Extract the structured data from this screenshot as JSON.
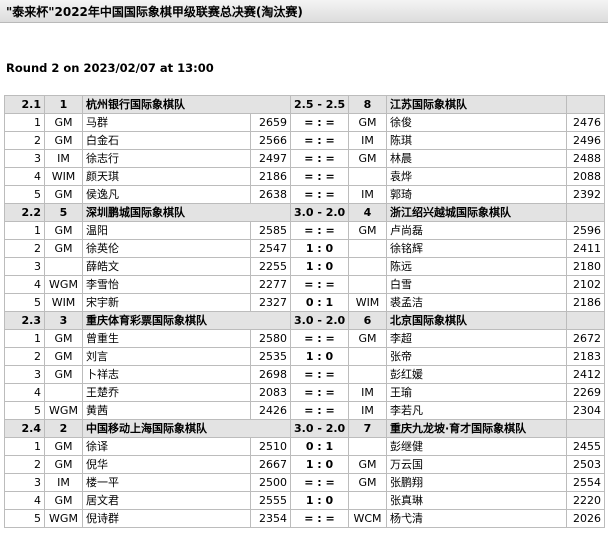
{
  "page": {
    "title": "\"泰来杯\"2022年中国国际象棋甲级联赛总决赛(淘汰赛)",
    "round_info": "Round 2 on 2023/02/07 at 13:00"
  },
  "matches": [
    {
      "board": "2.1",
      "team1_no": "1",
      "team1": "杭州银行国际象棋队",
      "score": "2.5 - 2.5",
      "team2_no": "8",
      "team2": "江苏国际象棋队",
      "games": [
        {
          "b": "1",
          "t1": "GM",
          "p1": "马群",
          "r1": "2659",
          "res": "= : =",
          "t2": "GM",
          "p2": "徐俊",
          "r2": "2476"
        },
        {
          "b": "2",
          "t1": "GM",
          "p1": "白金石",
          "r1": "2566",
          "res": "= : =",
          "t2": "IM",
          "p2": "陈琪",
          "r2": "2496"
        },
        {
          "b": "3",
          "t1": "IM",
          "p1": "徐志行",
          "r1": "2497",
          "res": "= : =",
          "t2": "GM",
          "p2": "林晨",
          "r2": "2488"
        },
        {
          "b": "4",
          "t1": "WIM",
          "p1": "颜天琪",
          "r1": "2186",
          "res": "= : =",
          "t2": "",
          "p2": "袁烨",
          "r2": "2088"
        },
        {
          "b": "5",
          "t1": "GM",
          "p1": "侯逸凡",
          "r1": "2638",
          "res": "= : =",
          "t2": "IM",
          "p2": "郭琦",
          "r2": "2392"
        }
      ]
    },
    {
      "board": "2.2",
      "team1_no": "5",
      "team1": "深圳鹏城国际象棋队",
      "score": "3.0 - 2.0",
      "team2_no": "4",
      "team2": "浙江绍兴越城国际象棋队",
      "games": [
        {
          "b": "1",
          "t1": "GM",
          "p1": "温阳",
          "r1": "2585",
          "res": "= : =",
          "t2": "GM",
          "p2": "卢尚磊",
          "r2": "2596"
        },
        {
          "b": "2",
          "t1": "GM",
          "p1": "徐英伦",
          "r1": "2547",
          "res": "1 : 0",
          "t2": "",
          "p2": "徐铭辉",
          "r2": "2411"
        },
        {
          "b": "3",
          "t1": "",
          "p1": "薛皓文",
          "r1": "2255",
          "res": "1 : 0",
          "t2": "",
          "p2": "陈远",
          "r2": "2180"
        },
        {
          "b": "4",
          "t1": "WGM",
          "p1": "李雪怡",
          "r1": "2277",
          "res": "= : =",
          "t2": "",
          "p2": "白雪",
          "r2": "2102"
        },
        {
          "b": "5",
          "t1": "WIM",
          "p1": "宋宇新",
          "r1": "2327",
          "res": "0 : 1",
          "t2": "WIM",
          "p2": "裘孟洁",
          "r2": "2186"
        }
      ]
    },
    {
      "board": "2.3",
      "team1_no": "3",
      "team1": "重庆体育彩票国际象棋队",
      "score": "3.0 - 2.0",
      "team2_no": "6",
      "team2": "北京国际象棋队",
      "games": [
        {
          "b": "1",
          "t1": "GM",
          "p1": "曾重生",
          "r1": "2580",
          "res": "= : =",
          "t2": "GM",
          "p2": "李超",
          "r2": "2672"
        },
        {
          "b": "2",
          "t1": "GM",
          "p1": "刘言",
          "r1": "2535",
          "res": "1 : 0",
          "t2": "",
          "p2": "张帝",
          "r2": "2183"
        },
        {
          "b": "3",
          "t1": "GM",
          "p1": "卜祥志",
          "r1": "2698",
          "res": "= : =",
          "t2": "",
          "p2": "彭红媛",
          "r2": "2412"
        },
        {
          "b": "4",
          "t1": "",
          "p1": "王楚乔",
          "r1": "2083",
          "res": "= : =",
          "t2": "IM",
          "p2": "王瑜",
          "r2": "2269"
        },
        {
          "b": "5",
          "t1": "WGM",
          "p1": "黄茜",
          "r1": "2426",
          "res": "= : =",
          "t2": "IM",
          "p2": "李若凡",
          "r2": "2304"
        }
      ]
    },
    {
      "board": "2.4",
      "team1_no": "2",
      "team1": "中国移动上海国际象棋队",
      "score": "3.0 - 2.0",
      "team2_no": "7",
      "team2": "重庆九龙坡·育才国际象棋队",
      "games": [
        {
          "b": "1",
          "t1": "GM",
          "p1": "徐译",
          "r1": "2510",
          "res": "0 : 1",
          "t2": "",
          "p2": "彭继健",
          "r2": "2455"
        },
        {
          "b": "2",
          "t1": "GM",
          "p1": "倪华",
          "r1": "2667",
          "res": "1 : 0",
          "t2": "GM",
          "p2": "万云国",
          "r2": "2503"
        },
        {
          "b": "3",
          "t1": "IM",
          "p1": "楼一平",
          "r1": "2500",
          "res": "= : =",
          "t2": "GM",
          "p2": "张鹏翔",
          "r2": "2554"
        },
        {
          "b": "4",
          "t1": "GM",
          "p1": "居文君",
          "r1": "2555",
          "res": "1 : 0",
          "t2": "",
          "p2": "张真琳",
          "r2": "2220"
        },
        {
          "b": "5",
          "t1": "WGM",
          "p1": "倪诗群",
          "r1": "2354",
          "res": "= : =",
          "t2": "WCM",
          "p2": "杨弋清",
          "r2": "2026"
        }
      ]
    }
  ]
}
